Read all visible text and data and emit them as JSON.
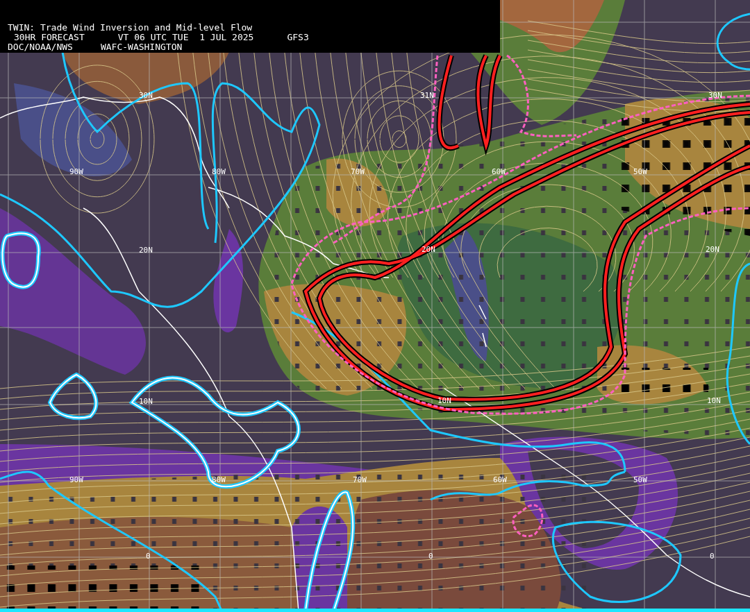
{
  "header": {
    "title": "TWIN: Trade Wind Inversion and Mid-level Flow",
    "forecast": "30HR FORECAST",
    "valid_time": "VT 06 UTC TUE  1 JUL 2025",
    "model": "GFS3",
    "agency": "DOC/NOAA/NWS",
    "center": "WAFC-WASHINGTON"
  },
  "map_labels": [
    "30N",
    "31N",
    "30N",
    "90W",
    "80W",
    "70W",
    "60W",
    "50W",
    "20N",
    "20N",
    "20N",
    "10N",
    "10N",
    "10N",
    "90W",
    "80W",
    "70W",
    "60W",
    "50W",
    "0",
    "0",
    "0"
  ]
}
